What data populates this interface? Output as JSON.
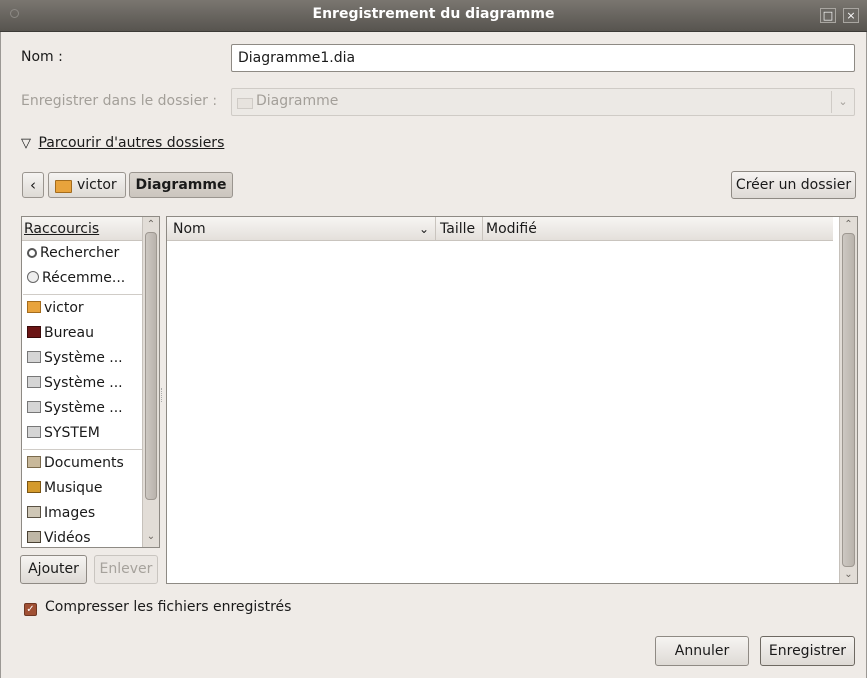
{
  "window": {
    "title": "Enregistrement du diagramme",
    "maximize_glyph": "□",
    "close_glyph": "×"
  },
  "name_field": {
    "label": "Nom :",
    "value": "Diagramme1.dia"
  },
  "save_in": {
    "label": "Enregistrer dans le dossier :",
    "value": "Diagramme"
  },
  "browse_toggle": {
    "arrow": "▽",
    "label": "Parcourir d'autres dossiers"
  },
  "path_bar": {
    "back_glyph": "‹",
    "items": [
      "victor",
      "Diagramme"
    ],
    "create_folder": "Créer un dossier"
  },
  "sidebar": {
    "header": "Raccourcis",
    "items": [
      {
        "label": "Rechercher",
        "icon": "search-icon"
      },
      {
        "label": "Récemme...",
        "icon": "recent-icon"
      },
      {
        "label": "victor",
        "icon": "home-folder-icon"
      },
      {
        "label": "Bureau",
        "icon": "desktop-icon"
      },
      {
        "label": "Système ...",
        "icon": "drive-icon"
      },
      {
        "label": "Système ...",
        "icon": "drive-icon"
      },
      {
        "label": "Système ...",
        "icon": "drive-icon"
      },
      {
        "label": "SYSTEM",
        "icon": "drive-icon"
      },
      {
        "label": "Documents",
        "icon": "documents-folder-icon"
      },
      {
        "label": "Musique",
        "icon": "music-folder-icon"
      },
      {
        "label": "Images",
        "icon": "images-folder-icon"
      },
      {
        "label": "Vidéos",
        "icon": "videos-folder-icon"
      }
    ],
    "add_button": "Ajouter",
    "remove_button": "Enlever"
  },
  "file_list": {
    "columns": {
      "name": "Nom",
      "sort_glyph": "⌄",
      "size": "Taille",
      "modified": "Modifié"
    }
  },
  "compress": {
    "label": "Compresser les fichiers enregistrés",
    "checked": true,
    "check_glyph": "✓"
  },
  "buttons": {
    "cancel": "Annuler",
    "save": "Enregistrer"
  },
  "colors": {
    "accent": "#a05034",
    "titlebar": "#5f5b56",
    "dialog_bg": "#efebe7"
  }
}
